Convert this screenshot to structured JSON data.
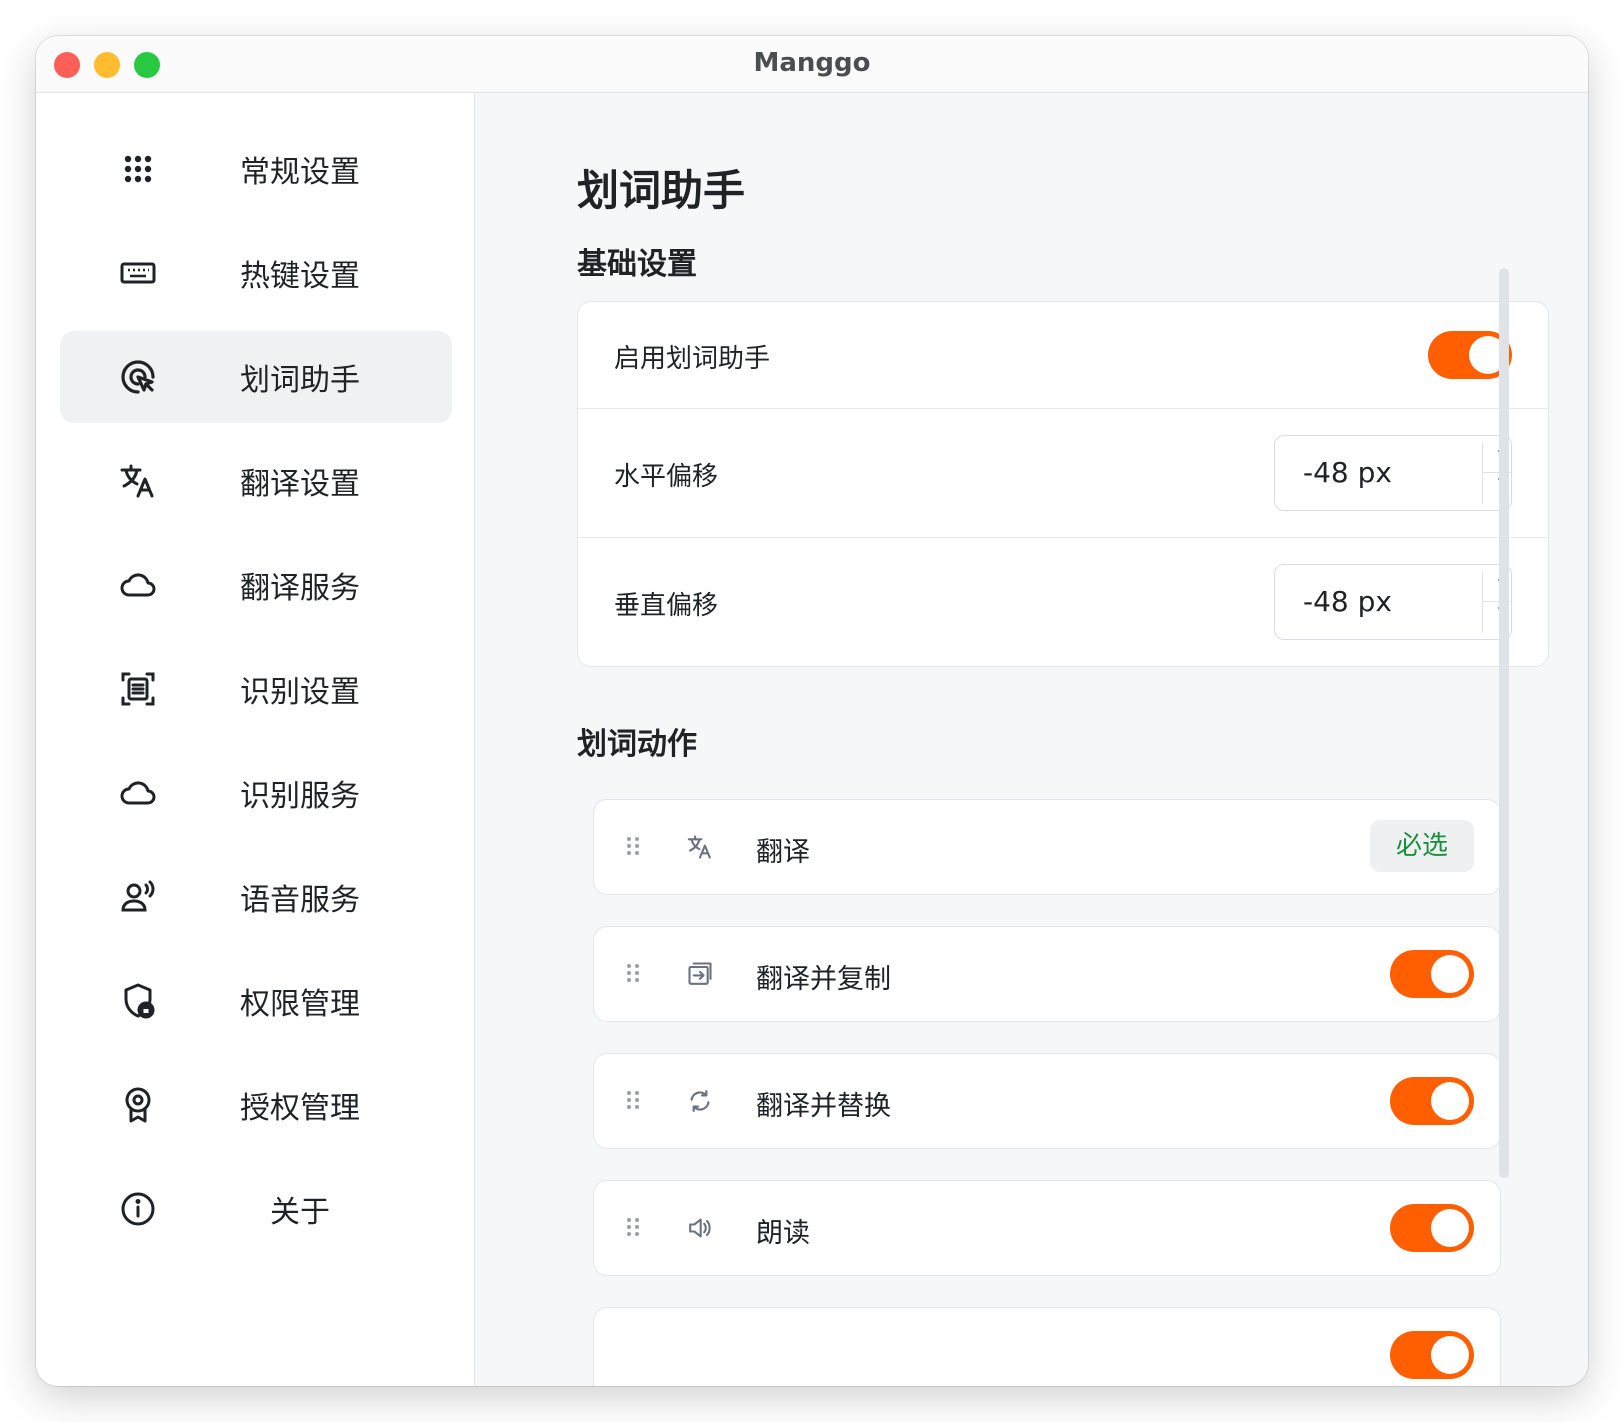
{
  "window": {
    "title": "Manggo"
  },
  "sidebar": {
    "items": [
      {
        "label": "常规设置",
        "icon": "grid-icon"
      },
      {
        "label": "热键设置",
        "icon": "keyboard-icon"
      },
      {
        "label": "划词助手",
        "icon": "cursor-click-icon",
        "active": true
      },
      {
        "label": "翻译设置",
        "icon": "translate-icon"
      },
      {
        "label": "翻译服务",
        "icon": "cloud-icon"
      },
      {
        "label": "识别设置",
        "icon": "scan-text-icon"
      },
      {
        "label": "识别服务",
        "icon": "cloud-icon"
      },
      {
        "label": "语音服务",
        "icon": "voice-user-icon"
      },
      {
        "label": "权限管理",
        "icon": "shield-lock-icon"
      },
      {
        "label": "授权管理",
        "icon": "award-icon"
      },
      {
        "label": "关于",
        "icon": "info-icon"
      }
    ]
  },
  "main": {
    "title": "划词助手",
    "basic": {
      "title": "基础设置",
      "enable_label": "启用划词助手",
      "enable_on": true,
      "h_offset_label": "水平偏移",
      "h_offset_value": "-48 px",
      "v_offset_label": "垂直偏移",
      "v_offset_value": "-48 px"
    },
    "actions": {
      "title": "划词动作",
      "items": [
        {
          "label": "翻译",
          "icon": "translate-icon",
          "required_label": "必选"
        },
        {
          "label": "翻译并复制",
          "icon": "copy-translate-icon",
          "on": true
        },
        {
          "label": "翻译并替换",
          "icon": "replace-icon",
          "on": true
        },
        {
          "label": "朗读",
          "icon": "speaker-icon",
          "on": true
        }
      ]
    }
  },
  "colors": {
    "accent": "#ff5f00",
    "required": "#1a8f3c"
  }
}
